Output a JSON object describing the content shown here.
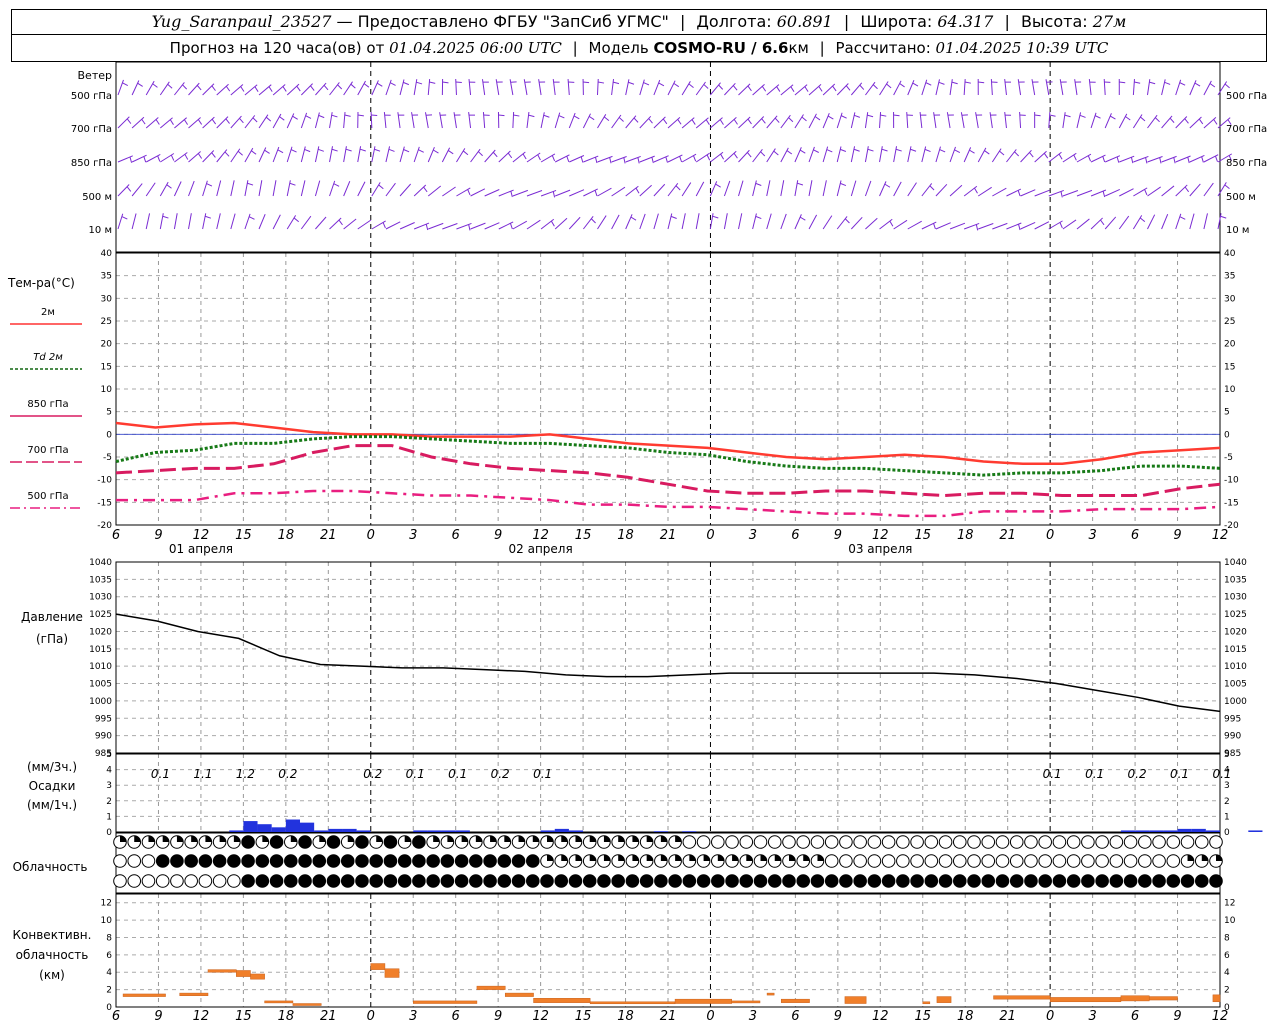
{
  "header": {
    "station": "Yug_Saranpaul_23527",
    "dash": "—",
    "provider": "Предоставлено ФГБУ \"ЗапСиб УГМС\"",
    "lon_label": "Долгота:",
    "lon_value": "60.891",
    "lat_label": "Широта:",
    "lat_value": "64.317",
    "alt_label": "Высота:",
    "alt_value": "27м",
    "forecast_prefix": "Прогноз на 120 часа(ов) от",
    "forecast_start": "01.04.2025 06:00 UTC",
    "model_label": "Модель",
    "model_name": "COSMO-RU / 6.6",
    "model_unit": "км",
    "calc_label": "Рассчитано:",
    "calc_time": "01.04.2025 10:39 UTC"
  },
  "wind_panel": {
    "title": "Ветер",
    "levels": [
      "500 гПа",
      "700 гПа",
      "850 гПа",
      "500 м",
      "10  м"
    ]
  },
  "temperature_panel": {
    "title": "Тем-ра(°С)",
    "legend": [
      {
        "label": "2м",
        "color": "#ff3333"
      },
      {
        "label": "Td  2м",
        "color": "#116611"
      },
      {
        "label": "850 гПа",
        "color": "#d81b60"
      },
      {
        "label": "700 гПа",
        "color": "#d81b60"
      },
      {
        "label": "500 гПа",
        "color": "#e91e80"
      }
    ]
  },
  "pressure_panel": {
    "title_line1": "Давление",
    "title_line2": "(гПа)"
  },
  "precip_panel": {
    "label_line1": "(мм/3ч.)",
    "label_line2": "Осадки",
    "label_line3": "(мм/1ч.)"
  },
  "cloud_panel": {
    "title": "Облачность"
  },
  "convective_panel": {
    "label_line1": "Конвективн.",
    "label_line2": "облачность",
    "label_line3": "(км)"
  },
  "time_axis": {
    "hour_labels": [
      "6",
      "9",
      "12",
      "15",
      "18",
      "21",
      "0",
      "3",
      "6",
      "9",
      "12",
      "15",
      "18",
      "21",
      "0",
      "3",
      "6",
      "9",
      "12",
      "15",
      "18",
      "21",
      "0",
      "3",
      "6",
      "9",
      "12"
    ],
    "days": [
      "01 апреля",
      "02 апреля",
      "03 апреля"
    ]
  },
  "chart_data": [
    {
      "type": "line",
      "title": "Тем-ра(°С)",
      "x_hours": [
        0,
        3,
        6,
        9,
        12,
        15,
        18,
        21,
        24,
        27,
        30,
        33,
        36,
        39,
        42,
        45,
        48,
        51,
        54,
        57,
        60,
        63,
        66,
        69,
        72,
        75,
        78
      ],
      "ylim": [
        -20,
        40
      ],
      "series": [
        {
          "name": "2м",
          "values": [
            2.5,
            1.5,
            2.2,
            2.5,
            1.5,
            0.5,
            0,
            0,
            -0.5,
            -0.5,
            -0.5,
            0,
            -1,
            -2,
            -2.5,
            -3,
            -4,
            -5,
            -5.5,
            -5,
            -4.5,
            -5,
            -6,
            -6.5,
            -6.5,
            -5.5,
            -4,
            -3.5,
            -3
          ]
        },
        {
          "name": "Td  2м",
          "values": [
            -6,
            -4,
            -3.5,
            -2,
            -2,
            -1,
            -0.5,
            -0.5,
            -1,
            -1.5,
            -2,
            -2,
            -2.5,
            -3,
            -4,
            -4.5,
            -6,
            -7,
            -7.5,
            -7.5,
            -8,
            -8.5,
            -9,
            -8.5,
            -8.5,
            -8,
            -7,
            -7,
            -7.5
          ]
        },
        {
          "name": "850 гПа",
          "values": [
            -8.5,
            -8,
            -7.5,
            -7.5,
            -6.5,
            -4,
            -2.5,
            -2.5,
            -5,
            -6.5,
            -7.5,
            -8,
            -8.5,
            -9.5,
            -11,
            -12.5,
            -13,
            -13,
            -12.5,
            -12.5,
            -13,
            -13.5,
            -13,
            -13,
            -13.5,
            -13.5,
            -13.5,
            -12,
            -11
          ]
        },
        {
          "name": "700 гПа",
          "values": [
            -14.5,
            -14.5,
            -14.5,
            -13,
            -13,
            -12.5,
            -12.5,
            -13,
            -13.5,
            -13.5,
            -14,
            -14.5,
            -15.5,
            -15.5,
            -16,
            -16,
            -16.5,
            -17,
            -17.5,
            -17.5,
            -18,
            -18,
            -17,
            -17,
            -17,
            -16.5,
            -16.5,
            -16.5,
            -16
          ]
        },
        {
          "name": "500 гПа",
          "values": [
            -14.5,
            -14.5,
            -14.5,
            -13,
            -13,
            -12.5,
            -12.5,
            -13,
            -13.5,
            -13.5,
            -14,
            -14.5,
            -15.5,
            -15.5,
            -16,
            -16,
            -16.5,
            -17,
            -17.5,
            -17.5,
            -18,
            -18,
            -17,
            -17,
            -17,
            -16.5,
            -16.5,
            -16.5,
            -16
          ]
        }
      ]
    },
    {
      "type": "line",
      "title": "Давление (гПа)",
      "ylim": [
        985,
        1040
      ],
      "series": [
        {
          "name": "Давление",
          "values": [
            1025,
            1023,
            1020,
            1018,
            1013,
            1010.5,
            1010,
            1009.5,
            1009.5,
            1009,
            1008.5,
            1007.5,
            1007,
            1007,
            1007.5,
            1008,
            1008,
            1008,
            1008,
            1008,
            1008,
            1007.5,
            1006.5,
            1005,
            1003,
            1001,
            998.5,
            997
          ]
        }
      ]
    },
    {
      "type": "bar",
      "title": "Осадки",
      "ylim": [
        0,
        5
      ],
      "labels_3h": [
        {
          "hour": 3,
          "value": "0.1"
        },
        {
          "hour": 6,
          "value": "1.1"
        },
        {
          "hour": 9,
          "value": "1.2"
        },
        {
          "hour": 12,
          "value": "0.2"
        },
        {
          "hour": 18,
          "value": "0.2"
        },
        {
          "hour": 21,
          "value": "0.1"
        },
        {
          "hour": 24,
          "value": "0.1"
        },
        {
          "hour": 27,
          "value": "0.2"
        },
        {
          "hour": 30,
          "value": "0.1"
        },
        {
          "hour": 66,
          "value": "0.1"
        },
        {
          "hour": 69,
          "value": "0.1"
        },
        {
          "hour": 72,
          "value": "0.2"
        },
        {
          "hour": 75,
          "value": "0.1"
        },
        {
          "hour": 78,
          "value": "0.1"
        }
      ],
      "hourly_bars": [
        {
          "hour": 8.5,
          "value": 0.1
        },
        {
          "hour": 9.5,
          "value": 0.7
        },
        {
          "hour": 10.5,
          "value": 0.5
        },
        {
          "hour": 11.5,
          "value": 0.3
        },
        {
          "hour": 12.5,
          "value": 0.8
        },
        {
          "hour": 13.5,
          "value": 0.6
        },
        {
          "hour": 14.5,
          "value": 0.1
        },
        {
          "hour": 15.5,
          "value": 0.2
        },
        {
          "hour": 16.5,
          "value": 0.2
        },
        {
          "hour": 17.5,
          "value": 0.1
        },
        {
          "hour": 21.5,
          "value": 0.1
        },
        {
          "hour": 22.5,
          "value": 0.1
        },
        {
          "hour": 23.5,
          "value": 0.1
        },
        {
          "hour": 24.5,
          "value": 0.1
        },
        {
          "hour": 30.5,
          "value": 0.1
        },
        {
          "hour": 31.5,
          "value": 0.2
        },
        {
          "hour": 32.5,
          "value": 0.1
        },
        {
          "hour": 38.5,
          "value": 0.05
        },
        {
          "hour": 40.5,
          "value": 0.05
        },
        {
          "hour": 71.5,
          "value": 0.1
        },
        {
          "hour": 72.5,
          "value": 0.1
        },
        {
          "hour": 73.5,
          "value": 0.1
        },
        {
          "hour": 74.5,
          "value": 0.1
        },
        {
          "hour": 75.5,
          "value": 0.2
        },
        {
          "hour": 76.5,
          "value": 0.2
        },
        {
          "hour": 77.5,
          "value": 0.1
        },
        {
          "hour": 80.5,
          "value": 0.1
        }
      ]
    },
    {
      "type": "bar",
      "title": "Конвективн. облачность (км)",
      "ylim": [
        0,
        13
      ],
      "segments": [
        {
          "start": 0.5,
          "end": 3.5,
          "base": 1.2,
          "top": 1.5
        },
        {
          "start": 4.5,
          "end": 6.5,
          "base": 1.3,
          "top": 1.6
        },
        {
          "start": 6.5,
          "end": 8.5,
          "base": 4,
          "top": 4.3
        },
        {
          "start": 8.5,
          "end": 9.5,
          "base": 3.5,
          "top": 4.2
        },
        {
          "start": 9.5,
          "end": 10.5,
          "base": 3.2,
          "top": 3.8
        },
        {
          "start": 10.5,
          "end": 12.5,
          "base": 0.6,
          "top": 0.7
        },
        {
          "start": 12.5,
          "end": 14.5,
          "base": 0.3,
          "top": 0.4
        },
        {
          "start": 18.0,
          "end": 19.0,
          "base": 4.3,
          "top": 5
        },
        {
          "start": 19.0,
          "end": 20.0,
          "base": 3.4,
          "top": 4.4
        },
        {
          "start": 21.0,
          "end": 25.5,
          "base": 0.4,
          "top": 0.7
        },
        {
          "start": 25.5,
          "end": 27.5,
          "base": 2,
          "top": 2.4
        },
        {
          "start": 27.5,
          "end": 29.5,
          "base": 1.2,
          "top": 1.6
        },
        {
          "start": 29.5,
          "end": 33.5,
          "base": 0.5,
          "top": 1
        },
        {
          "start": 33.5,
          "end": 39.5,
          "base": 0.4,
          "top": 0.6
        },
        {
          "start": 39.5,
          "end": 43.5,
          "base": 0.4,
          "top": 0.9
        },
        {
          "start": 43.5,
          "end": 45.5,
          "base": 0.5,
          "top": 0.7
        },
        {
          "start": 46.0,
          "end": 46.5,
          "base": 1.4,
          "top": 1.6
        },
        {
          "start": 47.0,
          "end": 49.0,
          "base": 0.5,
          "top": 0.9
        },
        {
          "start": 51.5,
          "end": 53.0,
          "base": 0.4,
          "top": 1.2
        },
        {
          "start": 57.0,
          "end": 57.5,
          "base": 0.4,
          "top": 0.6
        },
        {
          "start": 58.0,
          "end": 59.0,
          "base": 0.5,
          "top": 1.2
        },
        {
          "start": 62.0,
          "end": 66.0,
          "base": 0.9,
          "top": 1.3
        },
        {
          "start": 66.0,
          "end": 71.0,
          "base": 0.6,
          "top": 1.1
        },
        {
          "start": 71.0,
          "end": 73.0,
          "base": 0.7,
          "top": 1.3
        },
        {
          "start": 73.0,
          "end": 75.0,
          "base": 0.8,
          "top": 1.2
        },
        {
          "start": 77.5,
          "end": 78.0,
          "base": 0.6,
          "top": 1.4
        }
      ]
    }
  ]
}
